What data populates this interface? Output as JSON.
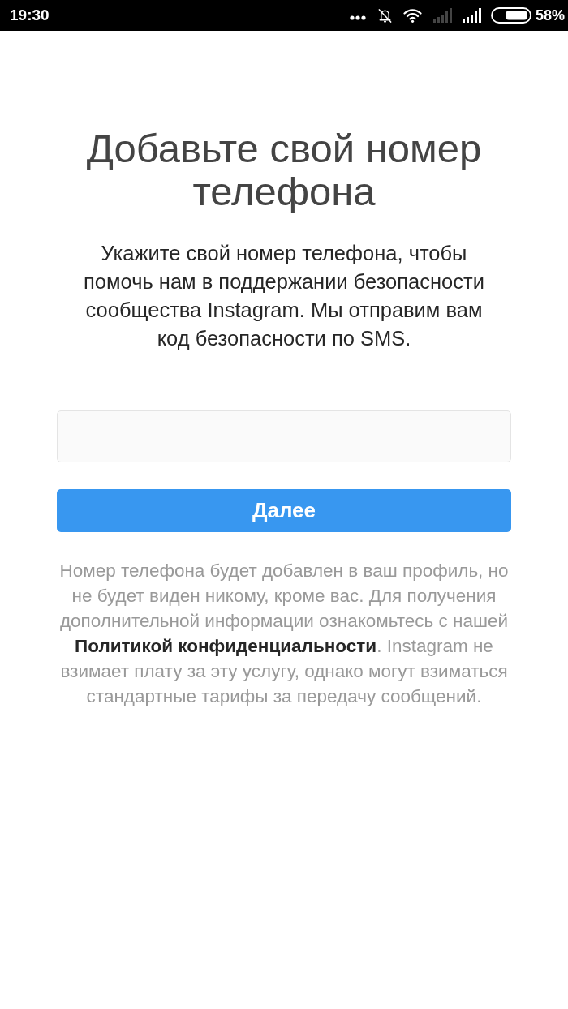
{
  "status_bar": {
    "time": "19:30",
    "battery": "58%"
  },
  "title": "Добавьте свой номер телефона",
  "description": "Укажите свой номер телефона, чтобы помочь нам в поддержании безопасности сообщества Instagram. Мы отправим вам код безопасности по SMS.",
  "phone_field": {
    "focused": false
  },
  "next_button": {
    "label": "Далее",
    "disabled": false
  },
  "disclaimer": {
    "text_before": "Номер телефона будет добавлен в ваш профиль, но не будет виден никому, кроме вас. Для получения дополнительной информации ознакомьтесь с нашей",
    "link": "Политикой конфиденциальности",
    "text_after": ". Instagram не взимает плату за эту услугу, однако могут взиматься стандартные тарифы за передачу сообщений."
  }
}
